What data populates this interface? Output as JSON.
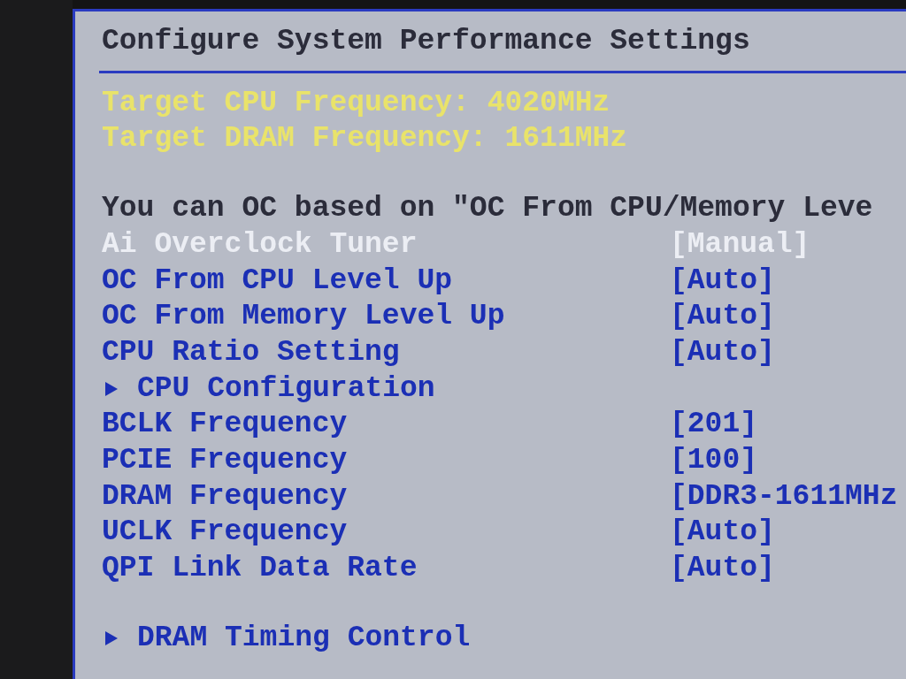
{
  "title": "Configure System Performance Settings",
  "targets": [
    {
      "label": "Target CPU Frequency:",
      "value": "4020MHz"
    },
    {
      "label": "Target DRAM Frequency:",
      "value": "1611MHz"
    }
  ],
  "notice": "You can OC based on \"OC From CPU/Memory Leve",
  "sections": [
    {
      "items": [
        {
          "kind": "setting",
          "label": "Ai Overclock Tuner",
          "value": "[Manual]",
          "disabled": true
        },
        {
          "kind": "setting",
          "label": "OC From CPU Level Up",
          "value": "[Auto]",
          "disabled": false
        },
        {
          "kind": "setting",
          "label": "OC From Memory Level Up",
          "value": "[Auto]",
          "disabled": false
        },
        {
          "kind": "setting",
          "label": "CPU Ratio Setting",
          "value": "[Auto]",
          "disabled": false
        },
        {
          "kind": "submenu",
          "label": "CPU Configuration",
          "disabled": false
        },
        {
          "kind": "setting",
          "label": "BCLK Frequency",
          "value": "[201]",
          "disabled": false
        },
        {
          "kind": "setting",
          "label": "PCIE Frequency",
          "value": "[100]",
          "disabled": false
        },
        {
          "kind": "setting",
          "label": "DRAM Frequency",
          "value": "[DDR3-1611MHz",
          "disabled": false
        },
        {
          "kind": "setting",
          "label": "UCLK Frequency",
          "value": "[Auto]",
          "disabled": false
        },
        {
          "kind": "setting",
          "label": "QPI Link Data Rate",
          "value": "[Auto]",
          "disabled": false
        }
      ]
    },
    {
      "items": [
        {
          "kind": "submenu",
          "label": "DRAM Timing Control",
          "disabled": false
        }
      ]
    }
  ]
}
